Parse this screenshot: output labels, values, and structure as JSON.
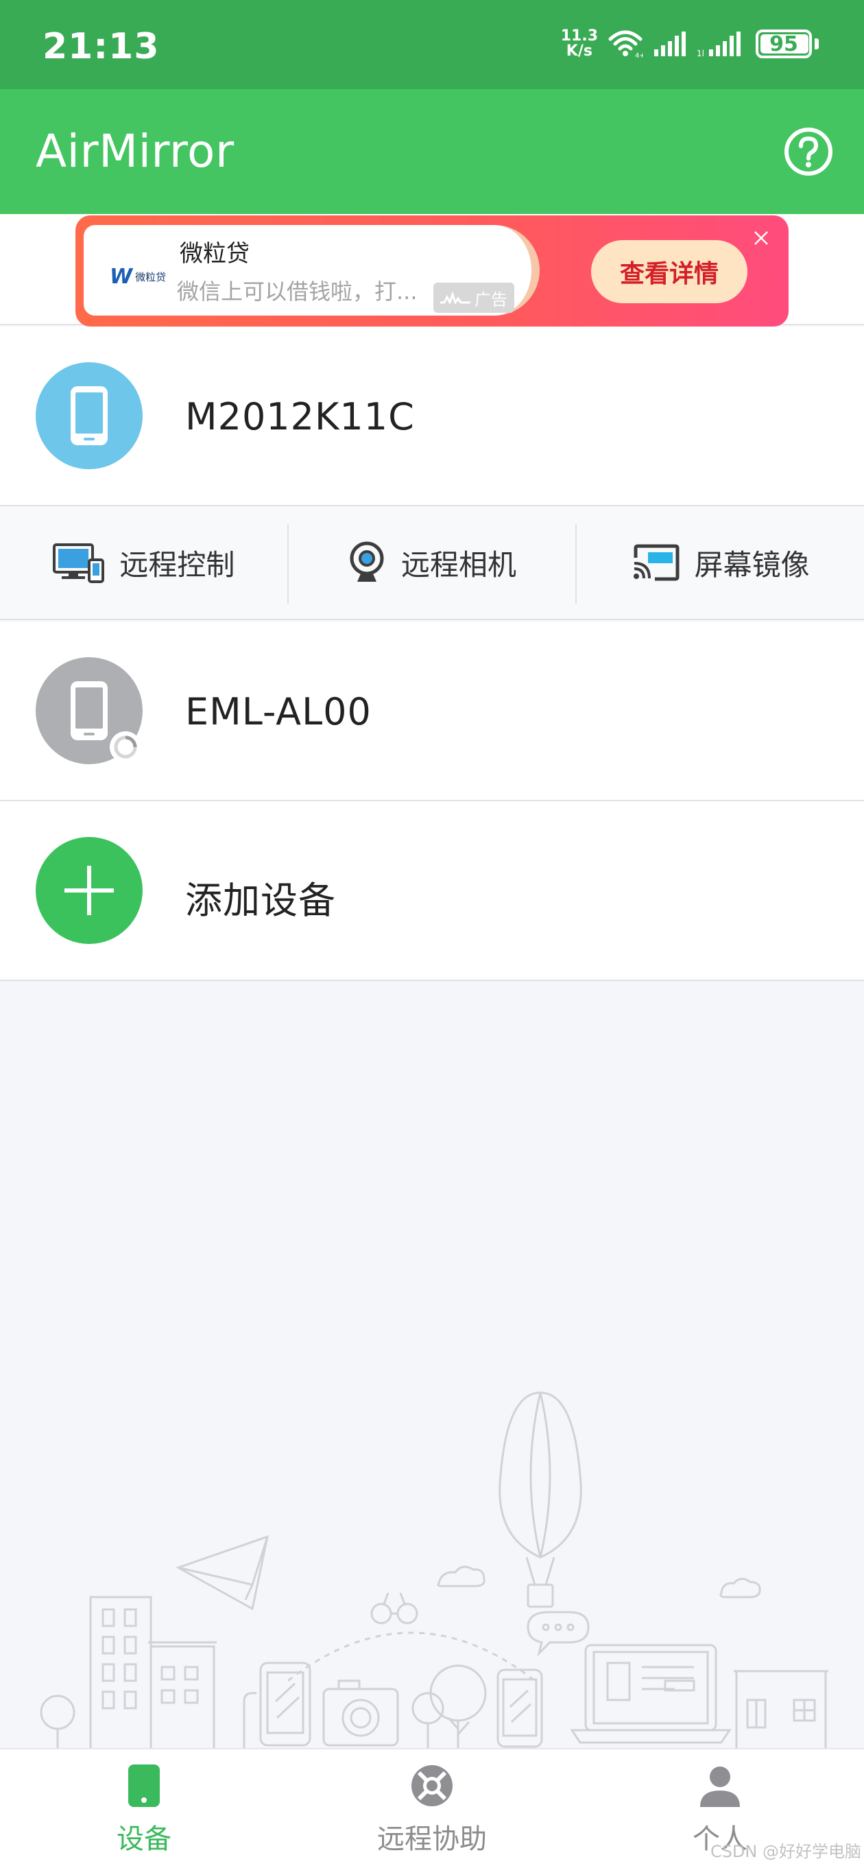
{
  "status_bar": {
    "time": "21:13",
    "net_speed_value": "11.3",
    "net_speed_unit": "K/s",
    "battery_level": "95",
    "wifi_icon": "wifi-icon",
    "signal_icon": "cellular-signal-icon"
  },
  "app_bar": {
    "title": "AirMirror",
    "help_icon": "help-circle-icon"
  },
  "ad": {
    "logo_text": "微粒贷",
    "name": "微粒贷",
    "description": "微信上可以借钱啦，打...",
    "badge": "广告",
    "cta": "查看详情",
    "close_icon": "close-icon"
  },
  "devices": [
    {
      "name": "M2012K11C",
      "icon": "phone-icon",
      "color": "#6ec6ea",
      "status": "online"
    },
    {
      "name": "EML-AL00",
      "icon": "phone-icon",
      "color": "#aeafb3",
      "status": "offline"
    }
  ],
  "actions": [
    {
      "label": "远程控制",
      "icon": "remote-control-icon"
    },
    {
      "label": "远程相机",
      "icon": "webcam-icon"
    },
    {
      "label": "屏幕镜像",
      "icon": "screen-cast-icon"
    }
  ],
  "add_device": {
    "label": "添加设备",
    "icon": "plus-icon",
    "color": "#3cc25c"
  },
  "bottom_nav": [
    {
      "label": "设备",
      "icon": "device-icon",
      "active": true
    },
    {
      "label": "远程协助",
      "icon": "lifebuoy-icon",
      "active": false
    },
    {
      "label": "个人",
      "icon": "person-icon",
      "active": false
    }
  ],
  "watermark": "CSDN @好好学电脑",
  "colors": {
    "status_bar": "#3aab55",
    "app_bar": "#44c562",
    "accent": "#3aba5c",
    "background": "#f5f6fa"
  }
}
